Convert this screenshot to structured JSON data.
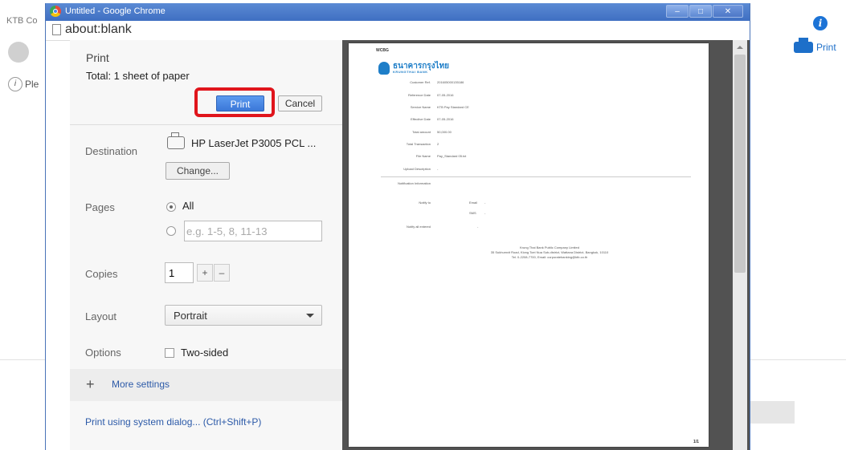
{
  "background": {
    "left_text": "KTB Co",
    "info_text": "Ple",
    "print_link": "Print",
    "info_icon": "i"
  },
  "window": {
    "title": "Untitled - Google Chrome",
    "url": "about:blank",
    "controls": {
      "minimize": "–",
      "maximize": "□",
      "close": "✕"
    }
  },
  "print_panel": {
    "title": "Print",
    "total": "Total: 1 sheet of paper",
    "print_button": "Print",
    "cancel_button": "Cancel",
    "destination": {
      "label": "Destination",
      "printer": "HP LaserJet P3005 PCL ...",
      "change_button": "Change..."
    },
    "pages": {
      "label": "Pages",
      "all_option": "All",
      "range_placeholder": "e.g. 1-5, 8, 11-13"
    },
    "copies": {
      "label": "Copies",
      "value": "1",
      "increment": "+",
      "decrement": "–"
    },
    "layout": {
      "label": "Layout",
      "selected": "Portrait"
    },
    "options": {
      "label": "Options",
      "two_sided": "Two-sided"
    },
    "more_settings": {
      "icon": "+",
      "label": "More settings"
    },
    "system_dialog": "Print using system dialog... (Ctrl+Shift+P)"
  },
  "preview": {
    "top_label": "WCBG",
    "bank_name_th": "ธนาคารกรุงไทย",
    "bank_name_en": "KRUNGTHAI BANK",
    "rows": [
      {
        "key": "Customer Ref.",
        "value": "201605000135186"
      },
      {
        "key": "Reference Date",
        "value": "07-05-2016"
      },
      {
        "key": "Service Name",
        "value": "KTB Pay Standard CE"
      },
      {
        "key": "Effective Date",
        "value": "07-05-2016"
      },
      {
        "key": "Total amount",
        "value": "50,000.00"
      },
      {
        "key": "Total Transaction",
        "value": "2"
      },
      {
        "key": "File Name",
        "value": "Pay_Standard 05.txt"
      },
      {
        "key": "Upload Description",
        "value": "-"
      }
    ],
    "notification_label": "Notification Information",
    "notify_to": {
      "key": "Notify to",
      "email": "Email",
      "sms": "SMS",
      "dash": "-"
    },
    "notify_all": {
      "key": "Notify all entered",
      "value": "-"
    },
    "footer_lines": [
      "Krung Thai Bank Public Company Limited",
      "35 Sukhumvit Road, Klong Toei Nua Sub-district, Wattana District, Bangkok, 10110",
      "Tel. 0-2208-7700, Email: corporatebanking@ktb.co.th"
    ],
    "page_number": "1/1"
  }
}
